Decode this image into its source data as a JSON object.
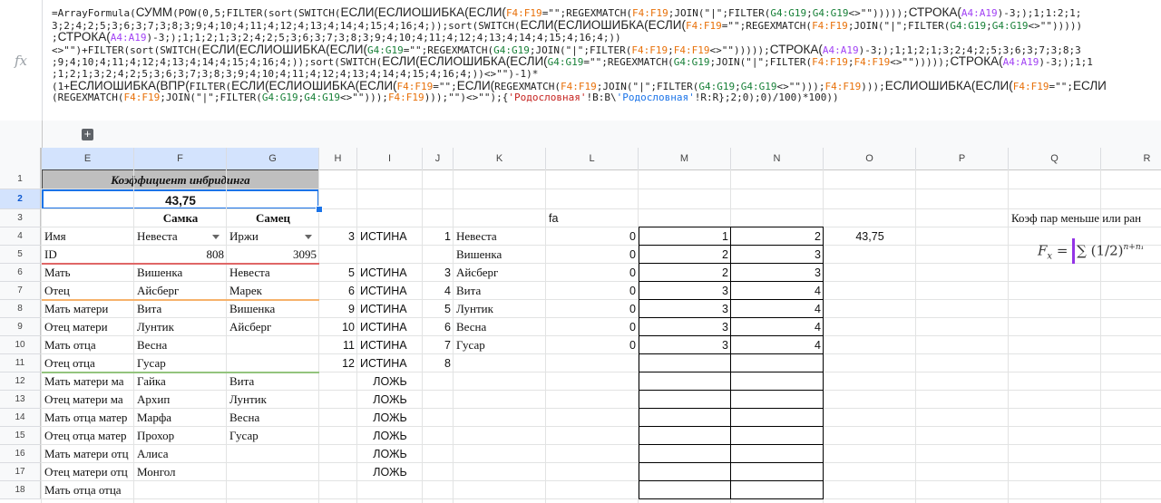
{
  "formula": {
    "lines": [
      [
        [
          "t",
          "=ArrayFormula("
        ],
        [
          "big",
          "СУММ"
        ],
        [
          "t",
          "(POW(0,5;FILTER(sort(SWITCH("
        ],
        [
          "big",
          "ЕСЛИ(ЕСЛИОШИБКА(ЕСЛИ("
        ],
        [
          "r",
          "F4:F19"
        ],
        [
          "t",
          "=\"\";REGEXMATCH("
        ],
        [
          "r",
          "F4:F19"
        ],
        [
          "t",
          ";JOIN(\"|\";FILTER("
        ],
        [
          "g",
          "G4:G19"
        ],
        [
          "t",
          ";"
        ],
        [
          "g",
          "G4:G19"
        ],
        [
          "t",
          "<>\"\")))));"
        ],
        [
          "big",
          "СТРОКА("
        ],
        [
          "v",
          "A4:A19"
        ],
        [
          "t",
          ")-3;);1;1:2;1;"
        ]
      ],
      [
        [
          "t",
          "3;2;4;2;5;3;6;3;7;3;8;3;9;4;10;4;11;4;12;4;13;4;14;4;15;4;16;4;));sort(SWITCH("
        ],
        [
          "big",
          "ЕСЛИ(ЕСЛИОШИБКА(ЕСЛИ("
        ],
        [
          "r",
          "F4:F19"
        ],
        [
          "t",
          "=\"\";REGEXMATCH("
        ],
        [
          "r",
          "F4:F19"
        ],
        [
          "t",
          ";JOIN(\"|\";FILTER("
        ],
        [
          "g",
          "G4:G19"
        ],
        [
          "t",
          ";"
        ],
        [
          "g",
          "G4:G19"
        ],
        [
          "t",
          "<>\"\")))))"
        ]
      ],
      [
        [
          "t",
          ";"
        ],
        [
          "big",
          "СТРОКА("
        ],
        [
          "v",
          "A4:A19"
        ],
        [
          "t",
          ")-3;);1;1;2;1;3;2;4;2;5;3;6;3;7;3;8;3;9;4;10;4;11;4;12;4;13;4;14;4;15;4;16;4;))"
        ]
      ],
      [
        [
          "t",
          "<>\"\")+FILTER(sort(SWITCH("
        ],
        [
          "big",
          "ЕСЛИ(ЕСЛИОШИБКА(ЕСЛИ("
        ],
        [
          "g",
          "G4:G19"
        ],
        [
          "t",
          "=\"\";REGEXMATCH("
        ],
        [
          "g",
          "G4:G19"
        ],
        [
          "t",
          ";JOIN(\"|\";FILTER("
        ],
        [
          "r",
          "F4:F19"
        ],
        [
          "t",
          ";"
        ],
        [
          "r",
          "F4:F19"
        ],
        [
          "t",
          "<>\"\")))));"
        ],
        [
          "big",
          "СТРОКА("
        ],
        [
          "v",
          "A4:A19"
        ],
        [
          "t",
          ")-3;);1;1;2;1;3;2;4;2;5;3;6;3;7;3;8;3"
        ]
      ],
      [
        [
          "t",
          ";9;4;10;4;11;4;12;4;13;4;14;4;15;4;16;4;));sort(SWITCH("
        ],
        [
          "big",
          "ЕСЛИ(ЕСЛИОШИБКА(ЕСЛИ("
        ],
        [
          "g",
          "G4:G19"
        ],
        [
          "t",
          "=\"\";REGEXMATCH("
        ],
        [
          "g",
          "G4:G19"
        ],
        [
          "t",
          ";JOIN(\"|\";FILTER("
        ],
        [
          "r",
          "F4:F19"
        ],
        [
          "t",
          ";"
        ],
        [
          "r",
          "F4:F19"
        ],
        [
          "t",
          "<>\"\")))));"
        ],
        [
          "big",
          "СТРОКА("
        ],
        [
          "v",
          "A4:A19"
        ],
        [
          "t",
          ")-3;);1;1"
        ]
      ],
      [
        [
          "t",
          ";1;2;1;3;2;4;2;5;3;6;3;7;3;8;3;9;4;10;4;11;4;12;4;13;4;14;4;15;4;16;4;))<>\"\")-1)*"
        ]
      ],
      [
        [
          "t",
          "(1+"
        ],
        [
          "big",
          "ЕСЛИОШИБКА(ВПР("
        ],
        [
          "t",
          "FILTER("
        ],
        [
          "big",
          "ЕСЛИ(ЕСЛИОШИБКА(ЕСЛИ("
        ],
        [
          "r",
          "F4:F19"
        ],
        [
          "t",
          "=\"\";"
        ],
        [
          "big",
          "ЕСЛИ("
        ],
        [
          "t",
          "REGEXMATCH("
        ],
        [
          "r",
          "F4:F19"
        ],
        [
          "t",
          ";JOIN(\"|\";FILTER("
        ],
        [
          "g",
          "G4:G19"
        ],
        [
          "t",
          ";"
        ],
        [
          "g",
          "G4:G19"
        ],
        [
          "t",
          "<>\"\")));"
        ],
        [
          "r",
          "F4:F19"
        ],
        [
          "t",
          ")));"
        ],
        [
          "big",
          "ЕСЛИОШИБКА(ЕСЛИ("
        ],
        [
          "r",
          "F4:F19"
        ],
        [
          "t",
          "=\"\";"
        ],
        [
          "big",
          "ЕСЛИ"
        ]
      ],
      [
        [
          "t",
          "(REGEXMATCH("
        ],
        [
          "r",
          "F4:F19"
        ],
        [
          "t",
          ";JOIN(\"|\";FILTER("
        ],
        [
          "g",
          "G4:G19"
        ],
        [
          "t",
          ";"
        ],
        [
          "g",
          "G4:G19"
        ],
        [
          "t",
          "<>\"\")));"
        ],
        [
          "r",
          "F4:F19"
        ],
        [
          "t",
          ")));\"\")<>\"\");{"
        ],
        [
          "s",
          "'Родословная'"
        ],
        [
          "t",
          "!B:B\\"
        ],
        [
          "b",
          "'Родословная'"
        ],
        [
          "t",
          "!R:R};2;0);0)/100)*100))"
        ]
      ]
    ]
  },
  "toolbar": {
    "add_label": "+"
  },
  "columns": [
    "E",
    "F",
    "G",
    "H",
    "I",
    "J",
    "K",
    "L",
    "M",
    "N",
    "O",
    "P",
    "Q",
    "R"
  ],
  "rows": [
    "1",
    "2",
    "3",
    "4",
    "5",
    "6",
    "7",
    "8",
    "9",
    "10",
    "11",
    "12",
    "13",
    "14",
    "15",
    "16",
    "17",
    "18"
  ],
  "header_block": {
    "title": "Коэффициент инбридинга",
    "value": "43,75"
  },
  "labels": {
    "female": "Самка",
    "male": "Самец",
    "fa": "fa",
    "coef_note": "Коэф пар меньше или ран"
  },
  "col_e": [
    "Имя",
    "ID",
    "Мать",
    "Отец",
    "Мать матери",
    "Отец матери",
    "Мать отца",
    "Отец отца",
    "Мать матери ма",
    "Отец матери ма",
    "Мать отца матер",
    "Отец отца матер",
    "Мать матери отц",
    "Отец матери отц",
    "Мать отца отца"
  ],
  "col_f": [
    "Невеста",
    "808",
    "Вишенка",
    "Айсберг",
    "Вита",
    "Лунтик",
    "Весна",
    "Гусар",
    "Гайка",
    "Архип",
    "Марфа",
    "Прохор",
    "Алиса",
    "Монгол",
    ""
  ],
  "col_g": [
    "Иржи",
    "3095",
    "Невеста",
    "Марек",
    "Вишенка",
    "Айсберг",
    "",
    "",
    "Вита",
    "Лунтик",
    "Весна",
    "Гусар",
    "",
    "",
    ""
  ],
  "col_h": [
    "3",
    "5",
    "6",
    "9",
    "10",
    "11",
    "12"
  ],
  "col_i": [
    "ИСТИНА",
    "ИСТИНА",
    "ИСТИНА",
    "ИСТИНА",
    "ИСТИНА",
    "ИСТИНА",
    "ИСТИНА",
    "ЛОЖЬ",
    "ЛОЖЬ",
    "ЛОЖЬ",
    "ЛОЖЬ",
    "ЛОЖЬ",
    "ЛОЖЬ"
  ],
  "col_j": [
    "1",
    "3",
    "4",
    "5",
    "6",
    "7",
    "8"
  ],
  "col_k": [
    "Невеста",
    "Вишенка",
    "Айсберг",
    "Вита",
    "Лунтик",
    "Весна",
    "Гусар"
  ],
  "col_l": [
    "0",
    "0",
    "0",
    "0",
    "0",
    "0",
    "0"
  ],
  "col_m": [
    "1",
    "2",
    "2",
    "3",
    "3",
    "3",
    "3"
  ],
  "col_n": [
    "2",
    "3",
    "3",
    "4",
    "4",
    "4",
    "4"
  ],
  "col_o": "43,75",
  "formula_image": {
    "lhs": "F",
    "sub": "x",
    "body": "∑ (1/2)",
    "exp": "n+n₁"
  },
  "colors": {
    "selection": "#1a73e8",
    "header_bg": "#bfbfbf",
    "red_line": "#e06666",
    "orange_line": "#f6b26b",
    "green_line": "#93c47d",
    "purple": "#9334e6"
  }
}
